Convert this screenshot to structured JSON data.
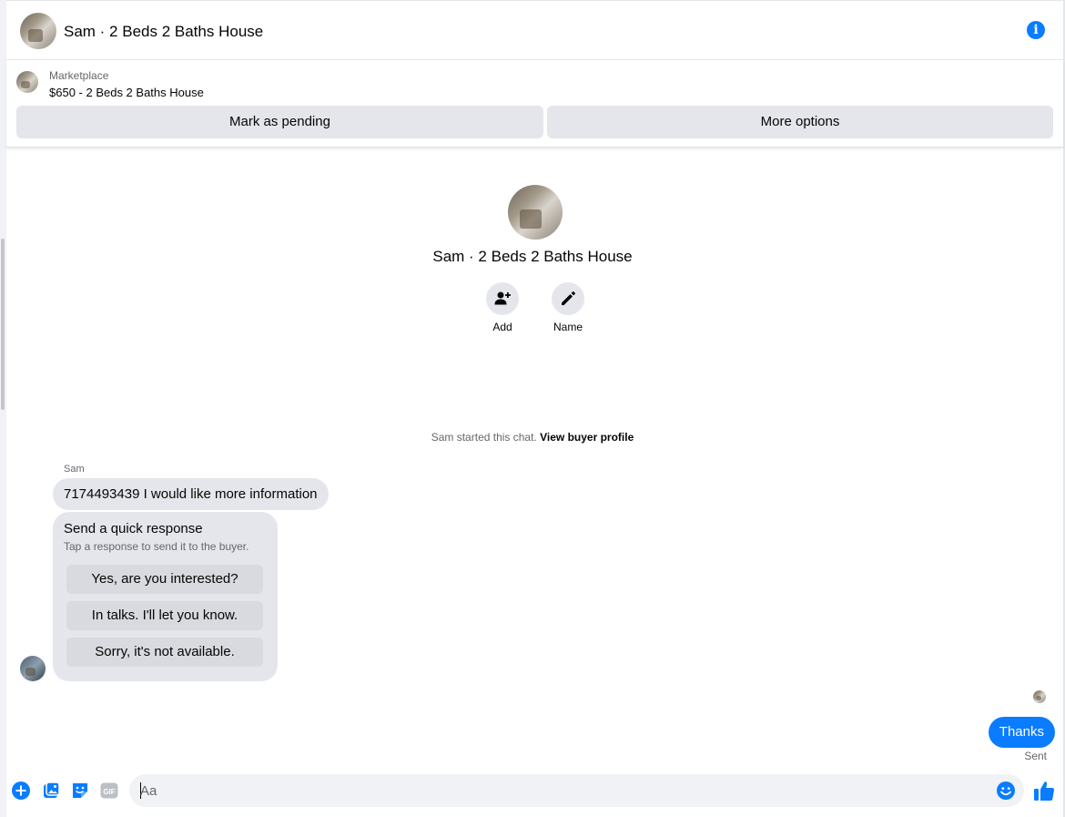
{
  "header": {
    "title": "Sam · 2 Beds 2 Baths House",
    "info_icon": "info-icon"
  },
  "listing": {
    "label": "Marketplace",
    "title": "$650 - 2 Beds 2 Baths House",
    "pending_label": "Mark as pending",
    "more_label": "More options"
  },
  "profile": {
    "name": "Sam · 2 Beds 2 Baths House",
    "actions": [
      {
        "label": "Add",
        "icon": "add-person-icon"
      },
      {
        "label": "Name",
        "icon": "pencil-icon"
      }
    ]
  },
  "chat": {
    "started_text": "Sam started this chat.",
    "view_profile_link": "View buyer profile",
    "sender": "Sam",
    "incoming_message": "7174493439 I would like more information",
    "quick_response": {
      "title": "Send a quick response",
      "subtitle": "Tap a response to send it to the buyer.",
      "options": [
        "Yes, are you interested?",
        "In talks. I'll let you know.",
        "Sorry, it's not available."
      ]
    },
    "outgoing_message": "Thanks",
    "status": "Sent"
  },
  "composer": {
    "placeholder": "Aa",
    "icons": [
      "plus-icon",
      "photo-icon",
      "sticker-icon",
      "gif-icon",
      "emoji-icon",
      "like-icon"
    ],
    "gif_text": "GIF"
  },
  "colors": {
    "accent": "#0a7cff",
    "bubble_gray": "#e4e6eb",
    "secondary_text": "#65676b"
  }
}
